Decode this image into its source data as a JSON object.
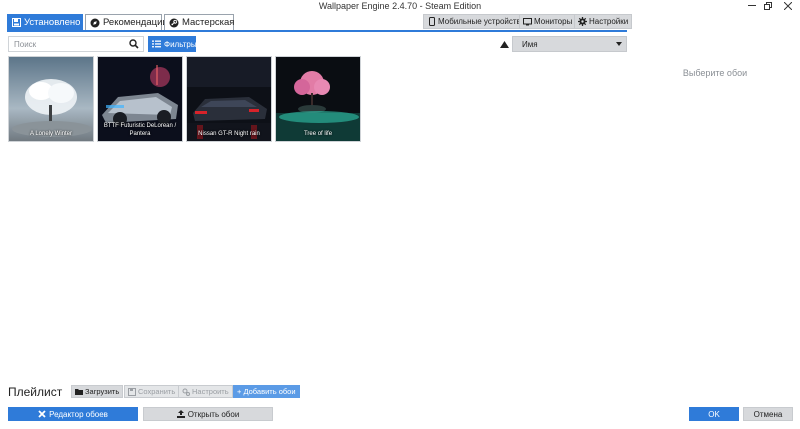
{
  "window": {
    "title": "Wallpaper Engine 2.4.70 - Steam Edition",
    "controls": [
      "more-icon",
      "restore-icon",
      "close-icon"
    ]
  },
  "tabs": [
    {
      "label": "Установлено",
      "icon": "save-icon",
      "active": true
    },
    {
      "label": "Рекомендации",
      "icon": "compass-icon",
      "active": false
    },
    {
      "label": "Мастерская",
      "icon": "steam-icon",
      "active": false
    }
  ],
  "top_buttons": {
    "mobile": "Мобильные устройства",
    "monitors": "Мониторы",
    "settings": "Настройки"
  },
  "search": {
    "placeholder": "Поиск",
    "value": ""
  },
  "filters_label": "Фильтры",
  "sort": {
    "direction": "ascending",
    "value": "Имя"
  },
  "wallpapers": [
    {
      "title": "A Lonely Winter"
    },
    {
      "title": "BTTF Futuristic DeLorean / Pantera"
    },
    {
      "title": "Nissan GT-R Night rain"
    },
    {
      "title": "Tree of life"
    }
  ],
  "right_panel": {
    "hint": "Выберите обои"
  },
  "playlist": {
    "title": "Плейлист",
    "load": "Загрузить",
    "save": "Сохранить",
    "configure": "Настроить",
    "add": "+ Добавить обои"
  },
  "bottom": {
    "editor": "Редактор обоев",
    "open": "Открыть обои",
    "ok": "OK",
    "cancel": "Отмена"
  },
  "colors": {
    "accent": "#2f7bd9"
  }
}
